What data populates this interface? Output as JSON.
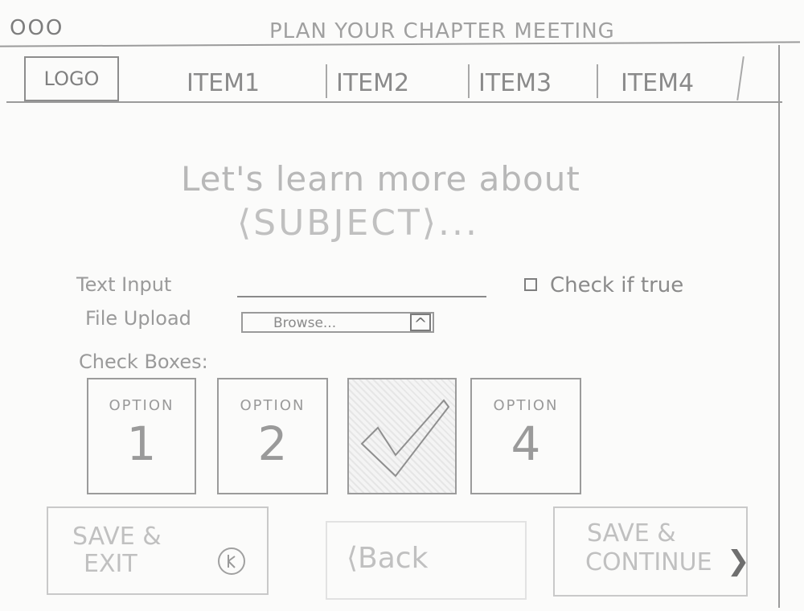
{
  "window": {
    "controls": "OOO",
    "title": "PLAN YOUR CHAPTER MEETING"
  },
  "nav": {
    "logo": "LOGO",
    "items": [
      "ITEM1",
      "ITEM2",
      "ITEM3",
      "ITEM4"
    ]
  },
  "heading": {
    "line1": "Let's learn more about",
    "line2": "⟨SUBJECT⟩..."
  },
  "form": {
    "text_input_label": "Text Input",
    "checkbox_label": "Check if true",
    "file_upload_label": "File Upload",
    "file_button": "Browse...",
    "file_icon": "^",
    "checkboxes_label": "Check Boxes:",
    "options": [
      {
        "title": "OPTION",
        "number": "1"
      },
      {
        "title": "OPTION",
        "number": "2"
      },
      {
        "title": "",
        "number": ""
      },
      {
        "title": "OPTION",
        "number": "4"
      }
    ]
  },
  "footer": {
    "save_exit_line1": "SAVE &",
    "save_exit_line2": "EXIT",
    "back": "⟨Back",
    "save_continue_line1": "SAVE &",
    "save_continue_line2": "CONTINUE",
    "continue_icon": "❯"
  }
}
